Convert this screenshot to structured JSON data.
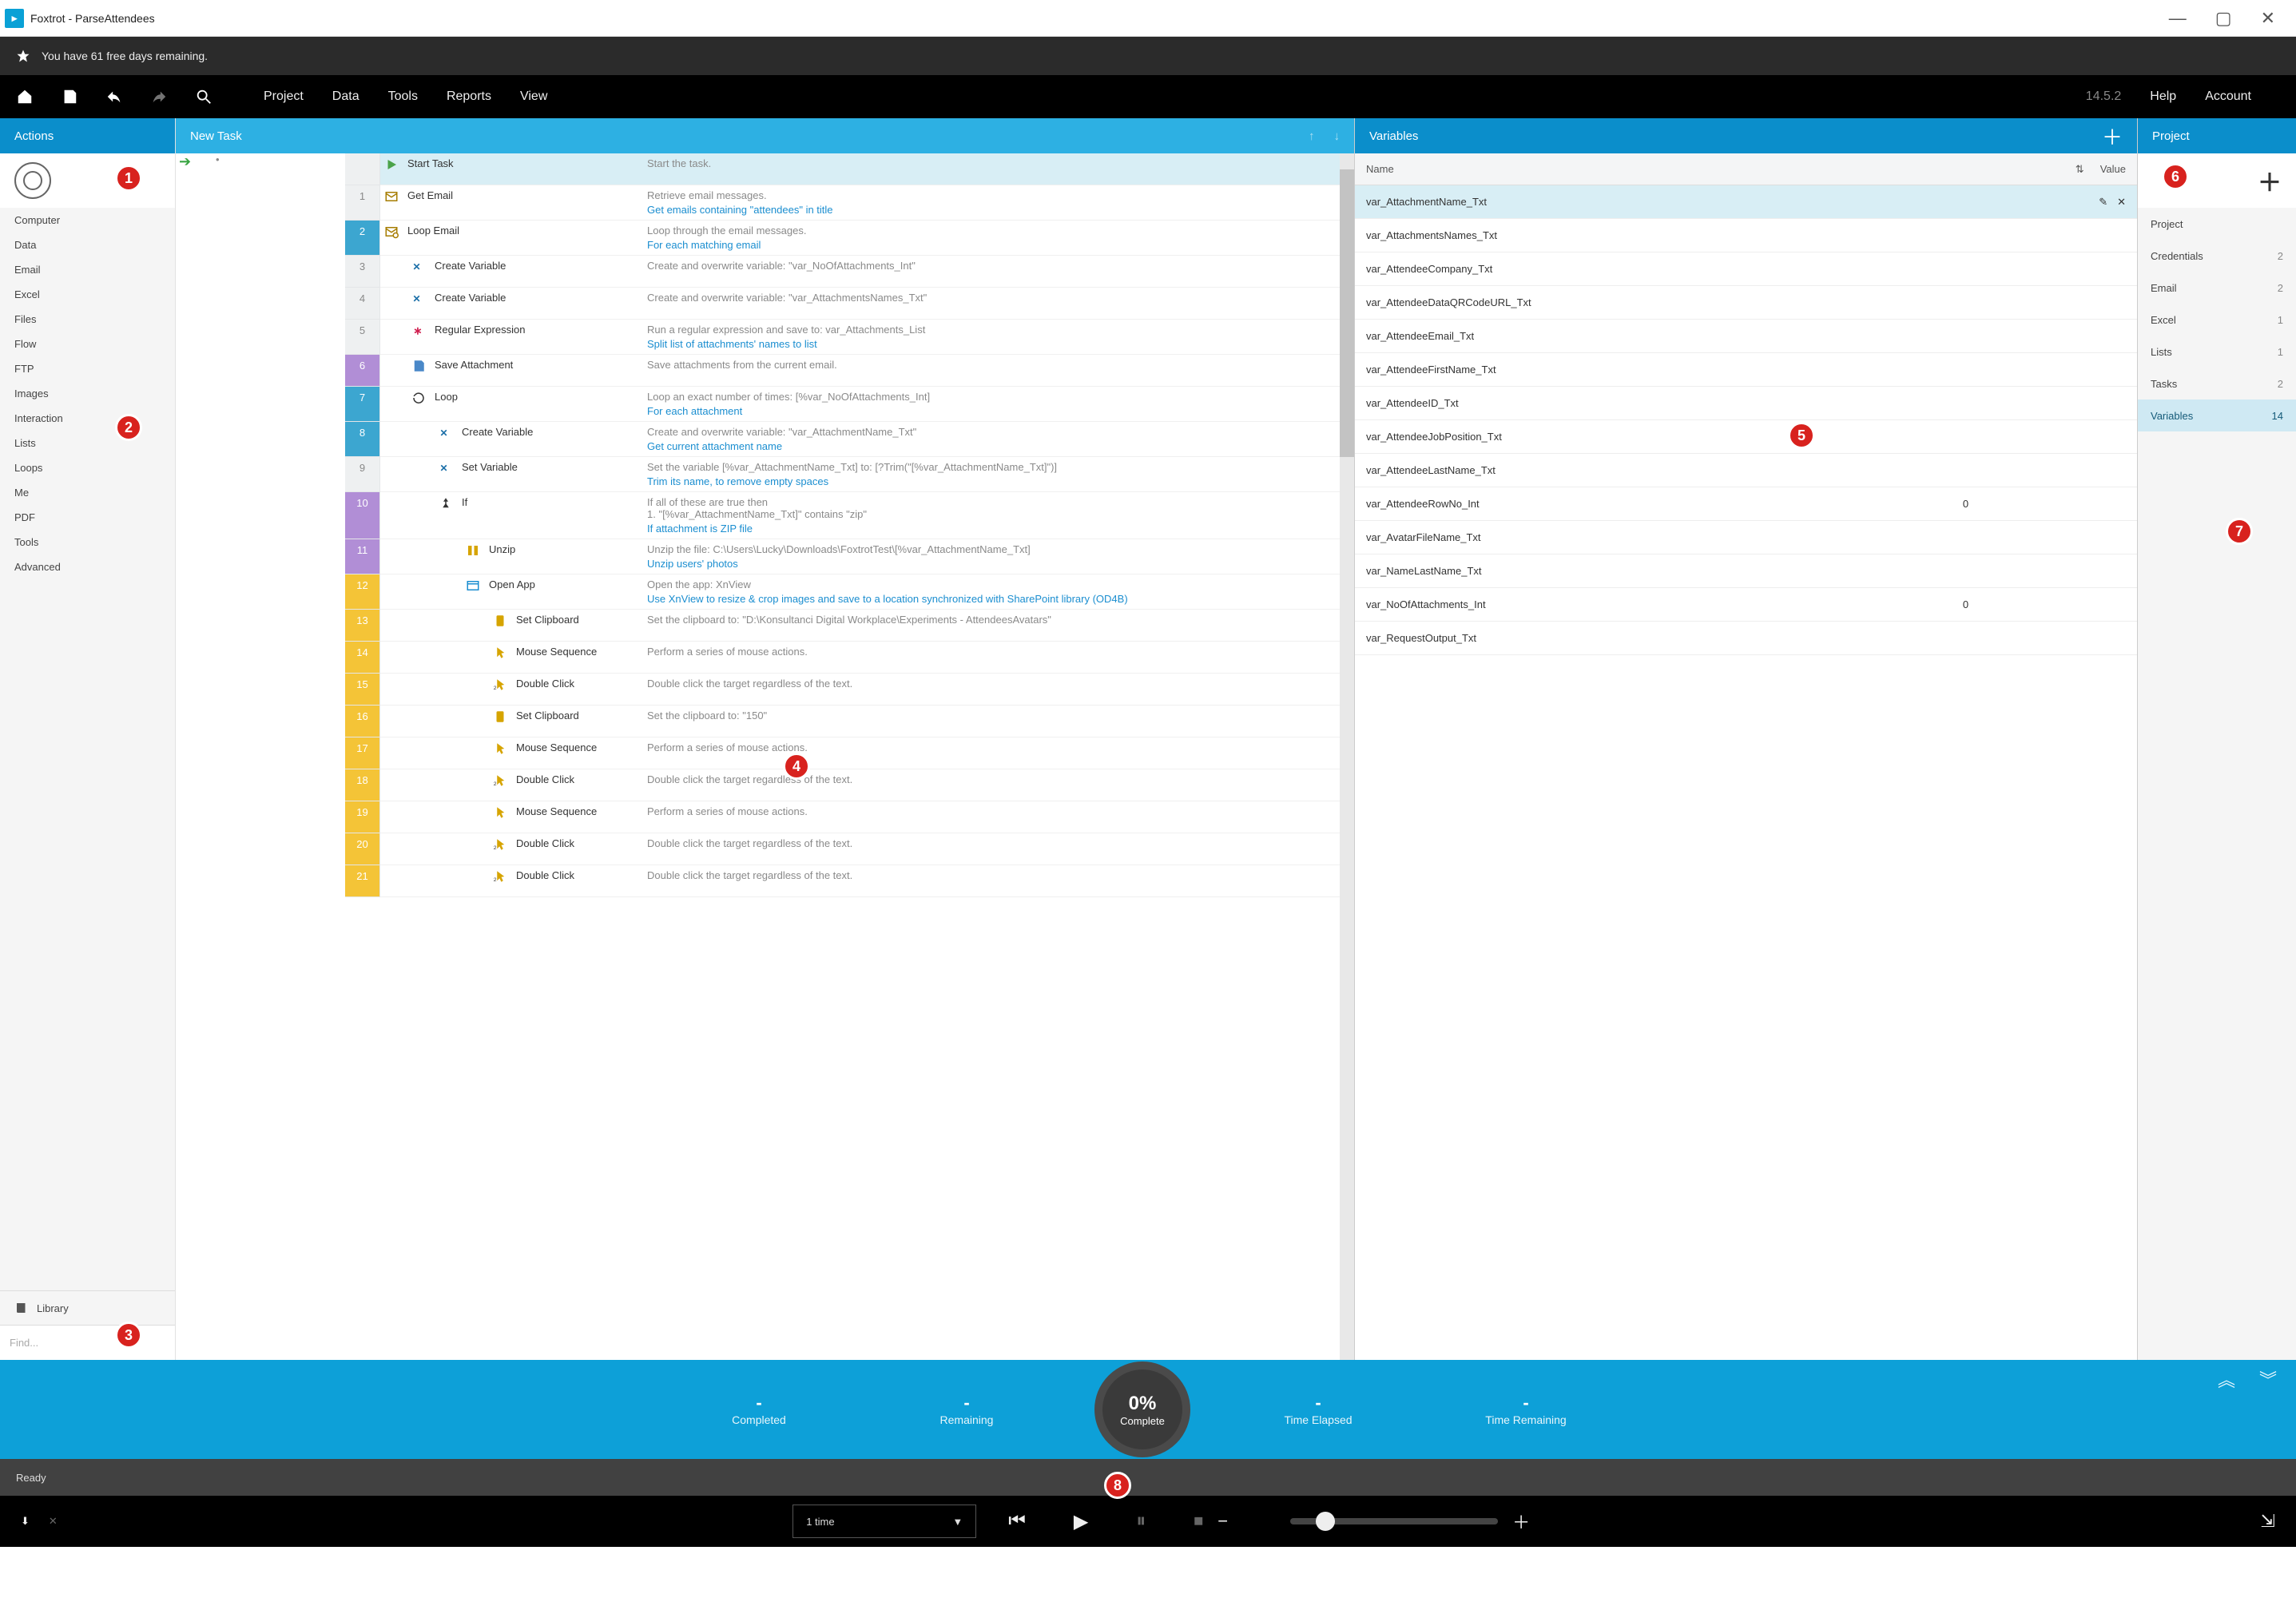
{
  "window": {
    "app": "Foxtrot",
    "project": "ParseAttendees",
    "title": "Foxtrot - ParseAttendees"
  },
  "trial_message": "You have 61 free days remaining.",
  "version": "14.5.2",
  "top_menu": [
    "Project",
    "Data",
    "Tools",
    "Reports",
    "View"
  ],
  "top_right": [
    "Help",
    "Account"
  ],
  "actions": {
    "title": "Actions",
    "categories": [
      "Computer",
      "Data",
      "Email",
      "Excel",
      "Files",
      "Flow",
      "FTP",
      "Images",
      "Interaction",
      "Lists",
      "Loops",
      "Me",
      "PDF",
      "Tools",
      "Advanced"
    ],
    "library_label": "Library",
    "find_placeholder": "Find..."
  },
  "task": {
    "title": "New Task",
    "steps": [
      {
        "line": "",
        "mark": "",
        "indent": 0,
        "icon": "start",
        "name": "Start Task",
        "desc": "Start the task.",
        "note": "",
        "first": true
      },
      {
        "line": "1",
        "mark": "",
        "indent": 0,
        "icon": "mail",
        "name": "Get Email",
        "desc": "Retrieve email messages.",
        "note": "Get emails containing \"attendees\" in title"
      },
      {
        "line": "2",
        "mark": "blue",
        "indent": 0,
        "icon": "mailloop",
        "name": "Loop Email",
        "desc": "Loop through the email messages.",
        "note": "For each matching email"
      },
      {
        "line": "3",
        "mark": "",
        "indent": 1,
        "icon": "var",
        "name": "Create Variable",
        "desc": "Create and overwrite variable: \"var_NoOfAttachments_Int\"",
        "note": ""
      },
      {
        "line": "4",
        "mark": "",
        "indent": 1,
        "icon": "var",
        "name": "Create Variable",
        "desc": "Create and overwrite variable: \"var_AttachmentsNames_Txt\"",
        "note": ""
      },
      {
        "line": "5",
        "mark": "",
        "indent": 1,
        "icon": "regex",
        "name": "Regular Expression",
        "desc": "Run a regular expression and save to: var_Attachments_List",
        "note": "Split list of attachments' names to list"
      },
      {
        "line": "6",
        "mark": "purple",
        "indent": 1,
        "icon": "saveatt",
        "name": "Save Attachment",
        "desc": "Save attachments from the current email.",
        "note": ""
      },
      {
        "line": "7",
        "mark": "blue",
        "indent": 1,
        "icon": "loop",
        "name": "Loop",
        "desc": "Loop an exact number of times: [%var_NoOfAttachments_Int]",
        "note": "For each attachment"
      },
      {
        "line": "8",
        "mark": "blue",
        "indent": 2,
        "icon": "var",
        "name": "Create Variable",
        "desc": "Create and overwrite variable: \"var_AttachmentName_Txt\"",
        "note": "Get current attachment name"
      },
      {
        "line": "9",
        "mark": "",
        "indent": 2,
        "icon": "setvar",
        "name": "Set Variable",
        "desc": "Set the variable [%var_AttachmentName_Txt] to: [?Trim(\"[%var_AttachmentName_Txt]\")]",
        "note": "Trim its name, to remove empty spaces"
      },
      {
        "line": "10",
        "mark": "purple",
        "indent": 2,
        "icon": "if",
        "name": "If",
        "desc": "If all of these are true then\n1. \"[%var_AttachmentName_Txt]\" contains \"zip\"",
        "note": "If attachment is ZIP file"
      },
      {
        "line": "11",
        "mark": "purple",
        "indent": 3,
        "icon": "unzip",
        "name": "Unzip",
        "desc": "Unzip the file: C:\\Users\\Lucky\\Downloads\\FoxtrotTest\\[%var_AttachmentName_Txt]",
        "note": "Unzip users' photos"
      },
      {
        "line": "12",
        "mark": "yellow",
        "indent": 3,
        "icon": "openapp",
        "name": "Open App",
        "desc": "Open the app: XnView",
        "note": "Use XnView to resize & crop images and save to a location synchronized with SharePoint library (OD4B)"
      },
      {
        "line": "13",
        "mark": "yellow",
        "indent": 4,
        "icon": "clip",
        "name": "Set Clipboard",
        "desc": "Set the clipboard to: \"D:\\Konsultanci Digital Workplace\\Experiments - AttendeesAvatars\"",
        "note": ""
      },
      {
        "line": "14",
        "mark": "yellow",
        "indent": 4,
        "icon": "mouse",
        "name": "Mouse Sequence",
        "desc": "Perform a series of mouse actions.",
        "note": ""
      },
      {
        "line": "15",
        "mark": "yellow",
        "indent": 4,
        "icon": "dbl",
        "name": "Double Click",
        "desc": "Double click the target regardless of the text.",
        "note": ""
      },
      {
        "line": "16",
        "mark": "yellow",
        "indent": 4,
        "icon": "clip",
        "name": "Set Clipboard",
        "desc": "Set the clipboard to: \"150\"",
        "note": ""
      },
      {
        "line": "17",
        "mark": "yellow",
        "indent": 4,
        "icon": "mouse",
        "name": "Mouse Sequence",
        "desc": "Perform a series of mouse actions.",
        "note": ""
      },
      {
        "line": "18",
        "mark": "yellow",
        "indent": 4,
        "icon": "dbl",
        "name": "Double Click",
        "desc": "Double click the target regardless of the text.",
        "note": ""
      },
      {
        "line": "19",
        "mark": "yellow",
        "indent": 4,
        "icon": "mouse",
        "name": "Mouse Sequence",
        "desc": "Perform a series of mouse actions.",
        "note": ""
      },
      {
        "line": "20",
        "mark": "yellow",
        "indent": 4,
        "icon": "dbl",
        "name": "Double Click",
        "desc": "Double click the target regardless of the text.",
        "note": ""
      },
      {
        "line": "21",
        "mark": "yellow",
        "indent": 4,
        "icon": "dbl",
        "name": "Double Click",
        "desc": "Double click the target regardless of the text.",
        "note": ""
      }
    ]
  },
  "variables": {
    "title": "Variables",
    "col_name": "Name",
    "col_value": "Value",
    "rows": [
      {
        "name": "var_AttachmentName_Txt",
        "value": "",
        "sel": true
      },
      {
        "name": "var_AttachmentsNames_Txt",
        "value": ""
      },
      {
        "name": "var_AttendeeCompany_Txt",
        "value": ""
      },
      {
        "name": "var_AttendeeDataQRCodeURL_Txt",
        "value": ""
      },
      {
        "name": "var_AttendeeEmail_Txt",
        "value": ""
      },
      {
        "name": "var_AttendeeFirstName_Txt",
        "value": ""
      },
      {
        "name": "var_AttendeeID_Txt",
        "value": ""
      },
      {
        "name": "var_AttendeeJobPosition_Txt",
        "value": ""
      },
      {
        "name": "var_AttendeeLastName_Txt",
        "value": ""
      },
      {
        "name": "var_AttendeeRowNo_Int",
        "value": "0"
      },
      {
        "name": "var_AvatarFileName_Txt",
        "value": ""
      },
      {
        "name": "var_NameLastName_Txt",
        "value": ""
      },
      {
        "name": "var_NoOfAttachments_Int",
        "value": "0"
      },
      {
        "name": "var_RequestOutput_Txt",
        "value": ""
      }
    ]
  },
  "project": {
    "title": "Project",
    "items": [
      {
        "label": "Project",
        "count": ""
      },
      {
        "label": "Credentials",
        "count": "2"
      },
      {
        "label": "Email",
        "count": "2"
      },
      {
        "label": "Excel",
        "count": "1"
      },
      {
        "label": "Lists",
        "count": "1"
      },
      {
        "label": "Tasks",
        "count": "2"
      },
      {
        "label": "Variables",
        "count": "14",
        "sel": true
      }
    ]
  },
  "progress": {
    "completed": {
      "val": "-",
      "lbl": "Completed"
    },
    "remaining": {
      "val": "-",
      "lbl": "Remaining"
    },
    "pct": "0%",
    "pct_lbl": "Complete",
    "elapsed": {
      "val": "-",
      "lbl": "Time Elapsed"
    },
    "timerem": {
      "val": "-",
      "lbl": "Time Remaining"
    }
  },
  "status": "Ready",
  "player": {
    "run_label": "1 time"
  },
  "badges": {
    "1": "1",
    "2": "2",
    "3": "3",
    "4": "4",
    "5": "5",
    "6": "6",
    "7": "7",
    "8": "8"
  }
}
